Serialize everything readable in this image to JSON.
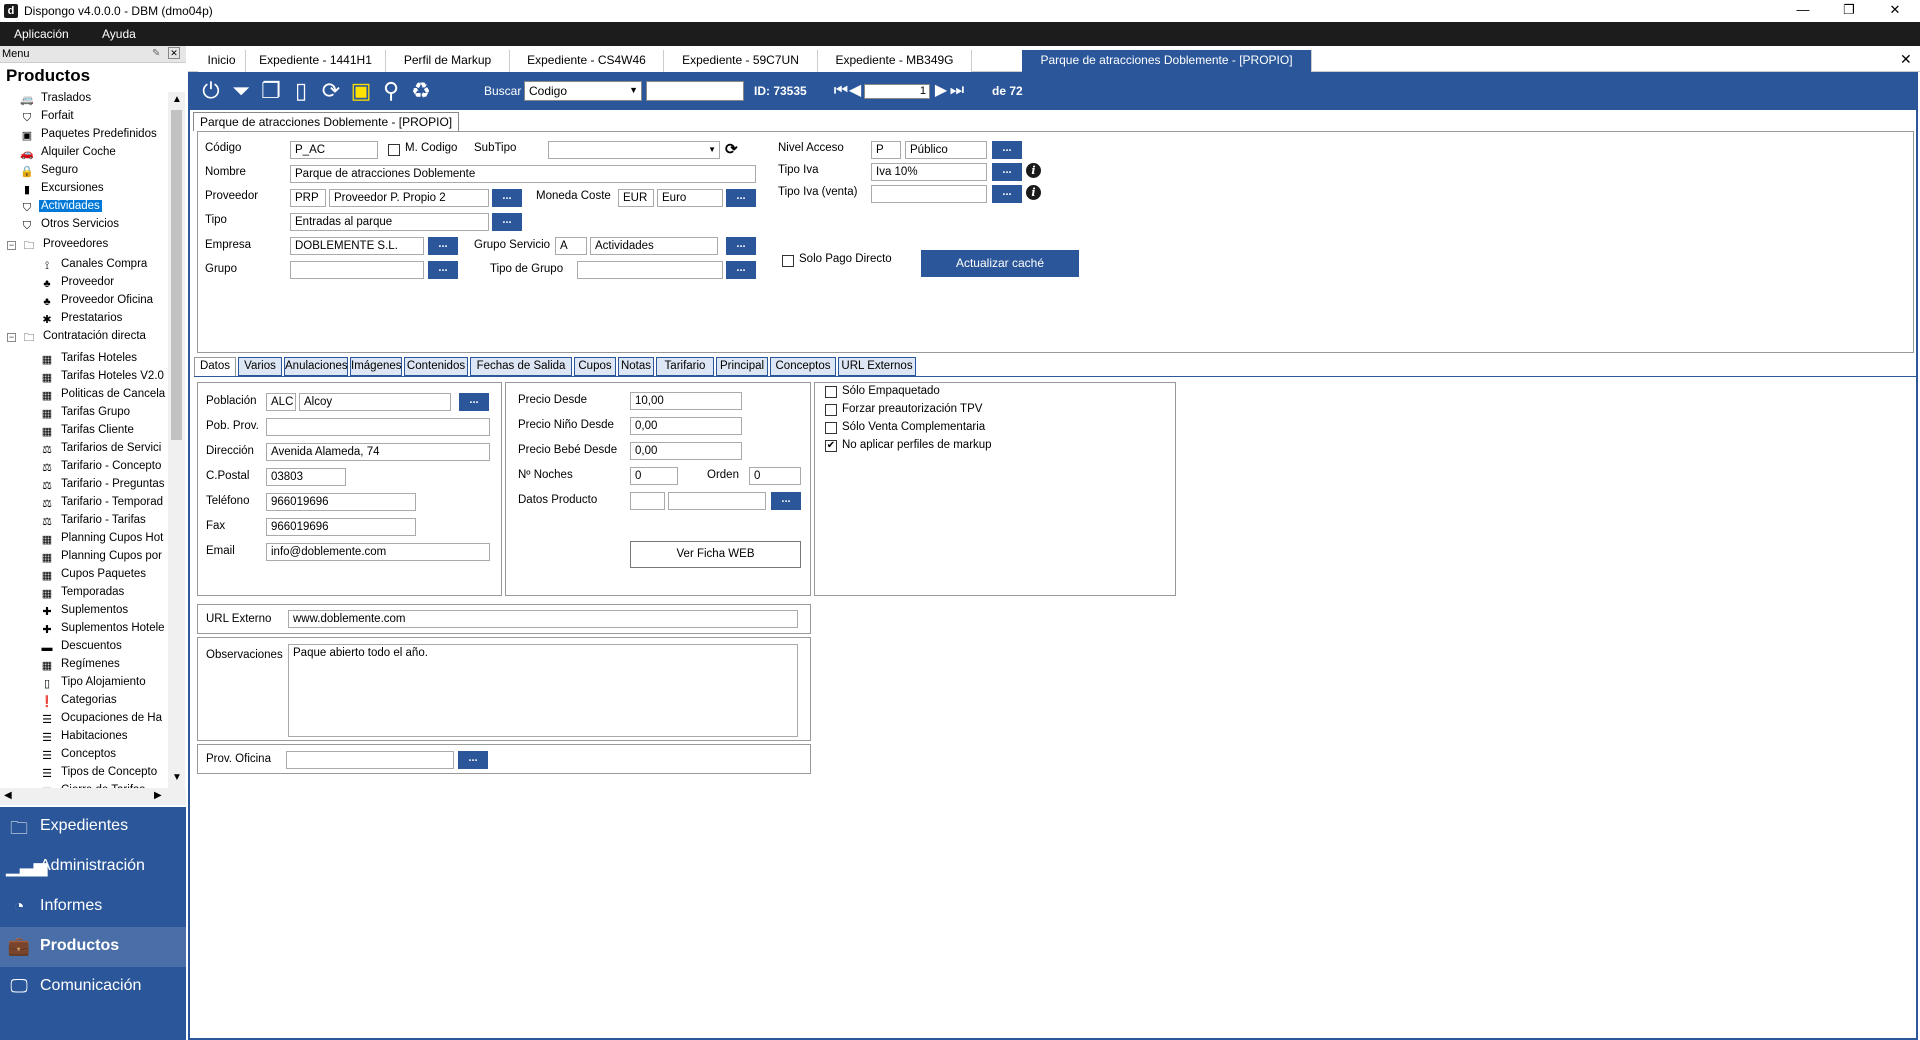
{
  "window": {
    "title": "Dispongo v4.0.0.0 - DBM (dmo04p)",
    "app_icon": "d"
  },
  "menubar": {
    "items": [
      "Aplicación",
      "Ayuda"
    ]
  },
  "menu_header": "Menu",
  "section_title": "Productos",
  "tree": [
    {
      "label": "Traslados",
      "icon": "van-icon",
      "glyph": "🚐"
    },
    {
      "label": "Forfait",
      "icon": "tag-icon",
      "glyph": "⛉"
    },
    {
      "label": "Paquetes Predefinidos",
      "icon": "package-icon",
      "glyph": "▣"
    },
    {
      "label": "Alquiler Coche",
      "icon": "car-icon",
      "glyph": "🚗"
    },
    {
      "label": "Seguro",
      "icon": "lock-icon",
      "glyph": "🔒"
    },
    {
      "label": "Excursiones",
      "icon": "bus-icon",
      "glyph": "▮"
    },
    {
      "label": "Actividades",
      "icon": "tag-icon",
      "glyph": "⛉"
    },
    {
      "label": "Otros Servicios",
      "icon": "tag-icon",
      "glyph": "⛉"
    },
    {
      "label": "Proveedores",
      "icon": "folder-icon",
      "glyph": "🗀"
    },
    {
      "label": "Canales Compra",
      "icon": "network-icon",
      "glyph": "⟟"
    },
    {
      "label": "Proveedor",
      "icon": "sitemap-icon",
      "glyph": "♣"
    },
    {
      "label": "Proveedor Oficina",
      "icon": "sitemap-icon",
      "glyph": "♣"
    },
    {
      "label": "Prestatarios",
      "icon": "puzzle-icon",
      "glyph": "✱"
    },
    {
      "label": "Contratación directa",
      "icon": "folder-icon",
      "glyph": "🗀"
    },
    {
      "label": "Tarifas Hoteles",
      "icon": "calendar-icon",
      "glyph": "▦"
    },
    {
      "label": "Tarifas Hoteles V2.0",
      "icon": "calendar-icon",
      "glyph": "▦"
    },
    {
      "label": "Politicas de Cancela",
      "icon": "calendar-icon",
      "glyph": "▦"
    },
    {
      "label": "Tarifas Grupo",
      "icon": "calendar-icon",
      "glyph": "▦"
    },
    {
      "label": "Tarifas Cliente",
      "icon": "calendar-icon",
      "glyph": "▦"
    },
    {
      "label": "Tarifarios de Servici",
      "icon": "gavel-icon",
      "glyph": "⚖"
    },
    {
      "label": "Tarifario - Concepto",
      "icon": "gavel-icon",
      "glyph": "⚖"
    },
    {
      "label": "Tarifario - Preguntas",
      "icon": "gavel-icon",
      "glyph": "⚖"
    },
    {
      "label": "Tarifario - Temporad",
      "icon": "gavel-icon",
      "glyph": "⚖"
    },
    {
      "label": "Tarifario - Tarifas",
      "icon": "gavel-icon",
      "glyph": "⚖"
    },
    {
      "label": "Planning Cupos Hot",
      "icon": "calendar-icon",
      "glyph": "▦"
    },
    {
      "label": "Planning Cupos por",
      "icon": "calendar-icon",
      "glyph": "▦"
    },
    {
      "label": "Cupos Paquetes",
      "icon": "calendar-icon",
      "glyph": "▦"
    },
    {
      "label": "Temporadas",
      "icon": "calendar-icon",
      "glyph": "▦"
    },
    {
      "label": "Suplementos",
      "icon": "plus-icon",
      "glyph": "✚"
    },
    {
      "label": "Suplementos Hotele",
      "icon": "plus-icon",
      "glyph": "✚"
    },
    {
      "label": "Descuentos",
      "icon": "minus-icon",
      "glyph": "▬"
    },
    {
      "label": "Regímenes",
      "icon": "calendar-icon",
      "glyph": "▦"
    },
    {
      "label": "Tipo Alojamiento",
      "icon": "phone-icon",
      "glyph": "▯"
    },
    {
      "label": "Categorias",
      "icon": "exclamation-icon",
      "glyph": "❗"
    },
    {
      "label": "Ocupaciones de Ha",
      "icon": "list-icon",
      "glyph": "☰"
    },
    {
      "label": "Habitaciones",
      "icon": "list-icon",
      "glyph": "☰"
    },
    {
      "label": "Conceptos",
      "icon": "list-icon",
      "glyph": "☰"
    },
    {
      "label": "Tipos de Concepto",
      "icon": "list-icon",
      "glyph": "☰"
    },
    {
      "label": "Cierre de Tarifas",
      "icon": "calendar-icon",
      "glyph": "▦"
    }
  ],
  "nav": [
    {
      "label": "Expedientes",
      "icon": "folder-icon",
      "glyph": "🗀"
    },
    {
      "label": "Administración",
      "icon": "bar-chart-icon",
      "glyph": "▁▃▅"
    },
    {
      "label": "Informes",
      "icon": "pie-chart-icon",
      "glyph": "◔"
    },
    {
      "label": "Productos",
      "icon": "briefcase-icon",
      "glyph": "💼"
    },
    {
      "label": "Comunicación",
      "icon": "monitor-icon",
      "glyph": "🖵"
    }
  ],
  "doc_tabs": [
    "Inicio",
    "Expediente - 1441H1",
    "Perfil de Markup",
    "Expediente - CS4W46",
    "Expediente - 59C7UN",
    "Expediente - MB349G",
    "Parque de atracciones Doblemente - [PROPIO]"
  ],
  "toolbar": {
    "buscar_label": "Buscar",
    "search_field": "Codigo",
    "search_value": "",
    "id_label": "ID: 73535",
    "page_value": "1",
    "page_of": "de 72"
  },
  "record_tab": "Parque de atracciones Doblemente - [PROPIO]",
  "header": {
    "codigo_label": "Código",
    "codigo": "P_AC",
    "mcodigo_label": "M. Codigo",
    "subtipo_label": "SubTipo",
    "subtipo": "",
    "nombre_label": "Nombre",
    "nombre": "Parque de atracciones Doblemente",
    "proveedor_label": "Proveedor",
    "proveedor_code": "PRP",
    "proveedor_name": "Proveedor P. Propio 2",
    "moneda_label": "Moneda Coste",
    "moneda_code": "EUR",
    "moneda_name": "Euro",
    "tipo_label": "Tipo",
    "tipo": "Entradas al parque",
    "empresa_label": "Empresa",
    "empresa": "DOBLEMENTE S.L.",
    "grupo_servicio_label": "Grupo Servicio",
    "grupo_servicio_code": "A",
    "grupo_servicio_name": "Actividades",
    "grupo_label": "Grupo",
    "grupo": "",
    "tipo_grupo_label": "Tipo de Grupo",
    "tipo_grupo": "",
    "nivel_acceso_label": "Nivel Acceso",
    "nivel_acceso_code": "P",
    "nivel_acceso_name": "Público",
    "tipo_iva_label": "Tipo Iva",
    "tipo_iva": "Iva 10%",
    "tipo_iva_venta_label": "Tipo Iva (venta)",
    "tipo_iva_venta": "",
    "solo_pago_label": "Solo Pago Directo",
    "actualizar_label": "Actualizar caché",
    "dots": "..."
  },
  "inner_tabs": [
    "Datos",
    "Varios",
    "Anulaciones",
    "Imágenes",
    "Contenidos",
    "Fechas de Salida",
    "Cupos",
    "Notas",
    "Tarifario",
    "Principal",
    "Conceptos",
    "URL Externos"
  ],
  "datos": {
    "poblacion_label": "Población",
    "poblacion_code": "ALC",
    "poblacion_name": "Alcoy",
    "pob_prov_label": "Pob. Prov.",
    "pob_prov": "",
    "direccion_label": "Dirección",
    "direccion": "Avenida Alameda, 74",
    "cpostal_label": "C.Postal",
    "cpostal": "03803",
    "telefono_label": "Teléfono",
    "telefono": "966019696",
    "fax_label": "Fax",
    "fax": "966019696",
    "email_label": "Email",
    "email": "info@doblemente.com",
    "precio_desde_label": "Precio Desde",
    "precio_desde": "10,00",
    "precio_nino_label": "Precio Niño Desde",
    "precio_nino": "0,00",
    "precio_bebe_label": "Precio Bebé Desde",
    "precio_bebe": "0,00",
    "noches_label": "Nº Noches",
    "noches": "0",
    "orden_label": "Orden",
    "orden": "0",
    "datos_producto_label": "Datos Producto",
    "ver_ficha_label": "Ver Ficha WEB",
    "checks": [
      {
        "label": "Sólo Empaquetado",
        "checked": false
      },
      {
        "label": "Forzar preautorización TPV",
        "checked": false
      },
      {
        "label": "Sólo Venta Complementaria",
        "checked": false
      },
      {
        "label": "No aplicar perfiles de markup",
        "checked": true
      }
    ],
    "url_label": "URL Externo",
    "url": "www.doblemente.com",
    "obs_label": "Observaciones",
    "obs": "Paque abierto todo el año.",
    "prov_oficina_label": "Prov. Oficina",
    "prov_oficina": ""
  }
}
